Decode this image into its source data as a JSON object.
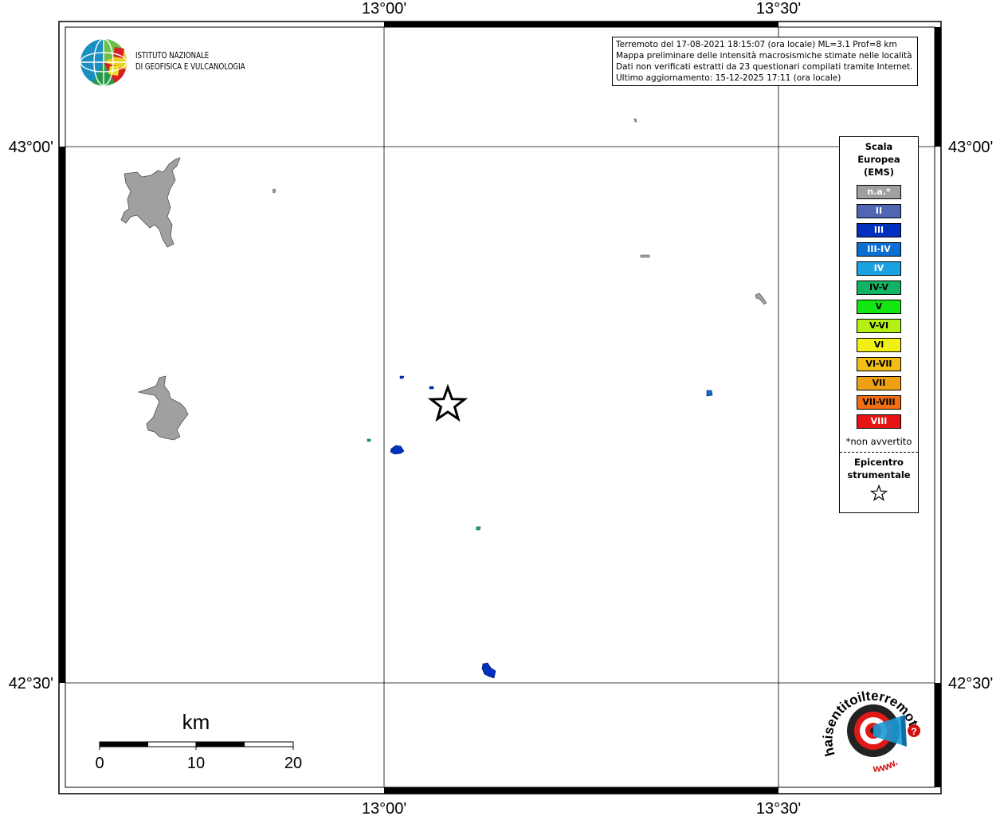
{
  "info": {
    "line1": "Terremoto del 17-08-2021 18:15:07 (ora locale) ML=3.1 Prof=8 km",
    "line2": "Mappa preliminare delle intensità macrosismiche stimate nelle località",
    "line3": "Dati non verificati estratti da 23 questionari compilati tramite Internet.",
    "line4": "Ultimo aggiornamento: 15-12-2025 17:11 (ora locale)"
  },
  "frame": {
    "lon_ticks": [
      "13°00'",
      "13°30'"
    ],
    "lat_ticks": [
      "43°00'",
      "42°30'"
    ]
  },
  "scale_bar": {
    "unit": "km",
    "labels": [
      "0",
      "10",
      "20"
    ]
  },
  "legend": {
    "title_lines": [
      "Scala",
      "Europea",
      "(EMS)"
    ],
    "items": [
      {
        "label": "n.a.*",
        "color": "#a0a0a0",
        "text_color": "#ffffff"
      },
      {
        "label": "II",
        "color": "#5066b4",
        "text_color": "#ffffff"
      },
      {
        "label": "III",
        "color": "#0030c0",
        "text_color": "#ffffff"
      },
      {
        "label": "III-IV",
        "color": "#0a6ed2",
        "text_color": "#ffffff"
      },
      {
        "label": "IV",
        "color": "#1aa3e0",
        "text_color": "#ffffff"
      },
      {
        "label": "IV-V",
        "color": "#10b464",
        "text_color": "#000000"
      },
      {
        "label": "V",
        "color": "#14e614",
        "text_color": "#000000"
      },
      {
        "label": "V-VI",
        "color": "#b4f014",
        "text_color": "#000000"
      },
      {
        "label": "VI",
        "color": "#f0f014",
        "text_color": "#000000"
      },
      {
        "label": "VI-VII",
        "color": "#f0be14",
        "text_color": "#000000"
      },
      {
        "label": "VII",
        "color": "#f0a014",
        "text_color": "#000000"
      },
      {
        "label": "VII-VIII",
        "color": "#f06e14",
        "text_color": "#000000"
      },
      {
        "label": "VIII",
        "color": "#e61414",
        "text_color": "#ffffff"
      }
    ],
    "note": "*non avvertito",
    "epicenter_lines": [
      "Epicentro",
      "strumentale"
    ]
  },
  "ingv": {
    "line1": "ISTITUTO NAZIONALE",
    "line2": "DI GEOFISICA E VULCANOLOGIA"
  },
  "hsit": {
    "arc_text": "haisentitoilterremoto.it",
    "prefix": "www."
  },
  "localities": [
    {
      "intensity": "n.a.",
      "color": "#a0a0a0"
    },
    {
      "intensity": "n.a.",
      "color": "#a0a0a0"
    },
    {
      "intensity": "III",
      "color": "#0030c0"
    },
    {
      "intensity": "III",
      "color": "#0030c0"
    },
    {
      "intensity": "III-IV",
      "color": "#0a6ed2"
    },
    {
      "intensity": "IV-V",
      "color": "#10b464"
    },
    {
      "intensity": "III",
      "color": "#0030c0"
    }
  ]
}
